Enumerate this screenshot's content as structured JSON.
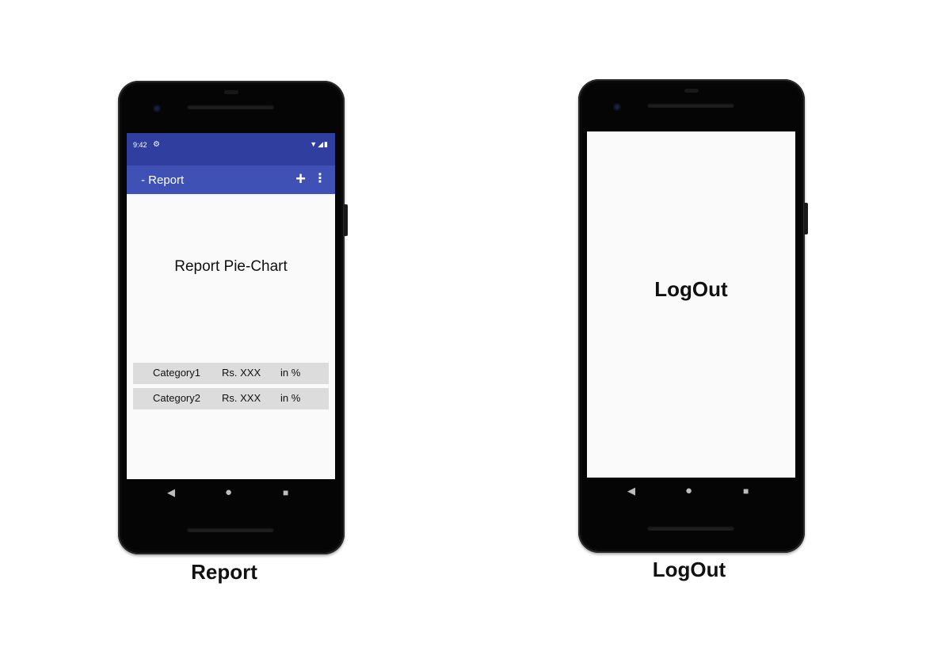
{
  "report_screen": {
    "status_bar": {
      "time": "9:42",
      "settings_icon": "gear-icon",
      "signal_icons": "wifi-icon, signal-icon, battery-icon"
    },
    "app_bar": {
      "title": "- Report",
      "add_icon": "+",
      "menu_icon": "⋮"
    },
    "chart_title": "Report Pie-Chart",
    "categories": [
      {
        "name": "Category1",
        "amount": "Rs. XXX",
        "percent": "in %"
      },
      {
        "name": "Category2",
        "amount": "Rs. XXX",
        "percent": "in %"
      }
    ],
    "nav": {
      "back": "◀",
      "home": "●",
      "recent": "■"
    },
    "caption": "Report"
  },
  "logout_screen": {
    "title": "LogOut",
    "nav": {
      "back": "◀",
      "home": "●",
      "recent": "■"
    },
    "caption": "LogOut"
  },
  "colors": {
    "status_bar": "#303f9f",
    "app_bar": "#3f51b5",
    "row_bg": "#dcdcdc",
    "screen_bg": "#fafafa"
  }
}
